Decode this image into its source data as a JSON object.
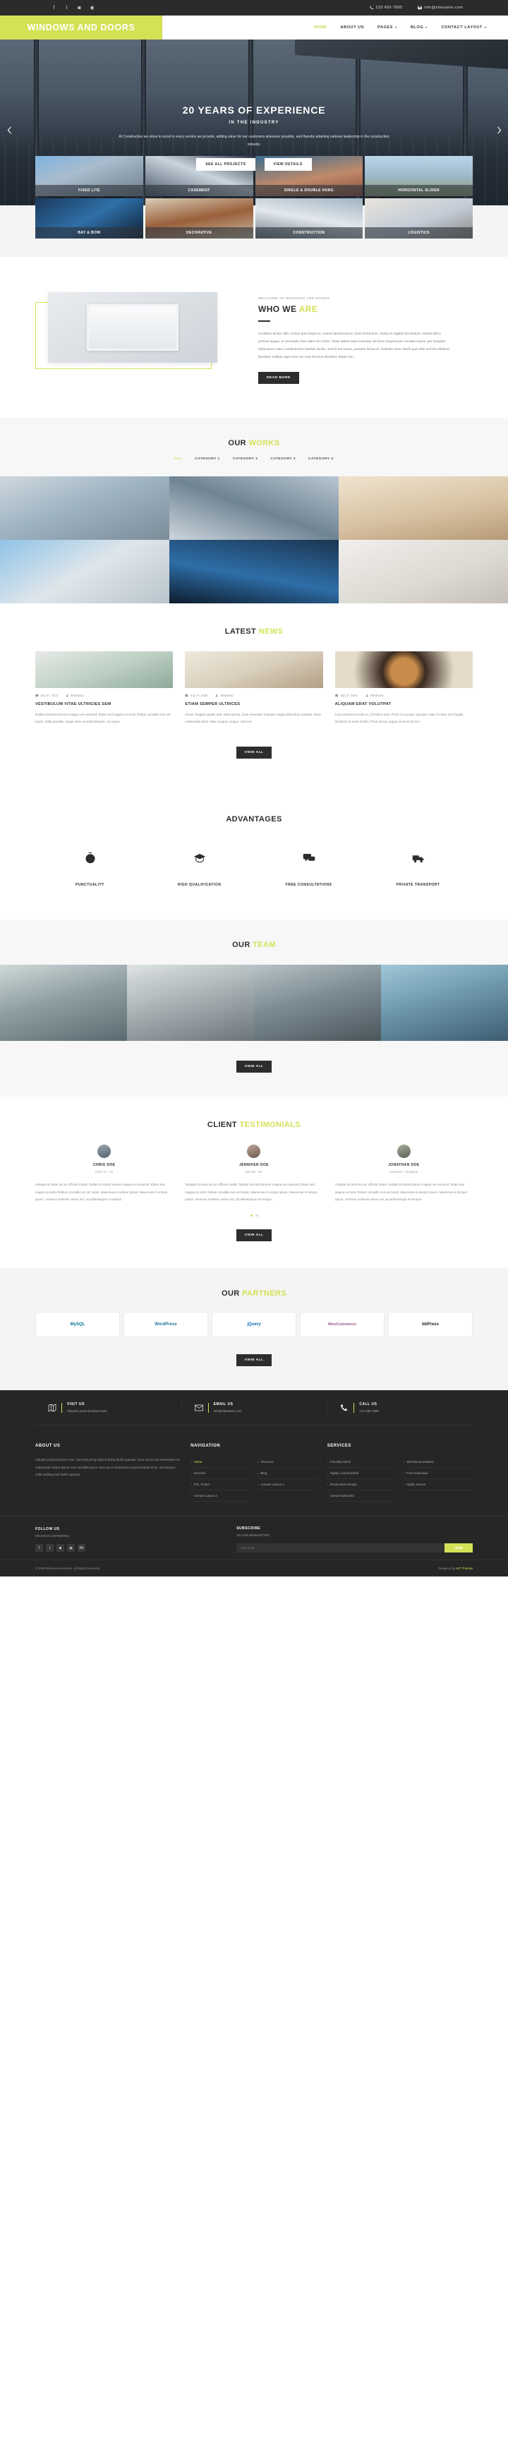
{
  "topbar": {
    "social": [
      "facebook-icon",
      "twitter-icon",
      "instagram-icon",
      "dribbble-icon"
    ],
    "phone": "233 456 7895",
    "email": "info@sitename.com"
  },
  "header": {
    "logo": "WINDOWS AND DOORS",
    "nav": [
      {
        "label": "HOME",
        "active": true,
        "caret": false
      },
      {
        "label": "ABOUT US",
        "active": false,
        "caret": false
      },
      {
        "label": "PAGES",
        "active": false,
        "caret": true
      },
      {
        "label": "BLOG",
        "active": false,
        "caret": true
      },
      {
        "label": "CONTACT LAYOUT",
        "active": false,
        "caret": true
      }
    ]
  },
  "hero": {
    "title": "20 YEARS OF EXPERIENCE",
    "subtitle": "IN THE INDUSTRY",
    "description": "At Construction we strive to excel in every service we provide, adding value for our customers wherever possible, and thereby attaining national leadership in the construction industry.",
    "primary_button": "SEE ALL PROJECTS",
    "secondary_button": "VIEW DETAILS"
  },
  "categories": [
    {
      "label": "FIXED LITE"
    },
    {
      "label": "CASEMENT"
    },
    {
      "label": "SINGLE & DOUBLE HUNG"
    },
    {
      "label": "HORIZONTAL SLIDER"
    },
    {
      "label": "BAY & BOW"
    },
    {
      "label": "DECORATIVE"
    },
    {
      "label": "CONSTRUCTION"
    },
    {
      "label": "LOGISTICS"
    }
  ],
  "who": {
    "eyebrow": "WELCOME TO WINDOWS AND DOORS",
    "title_main": "WHO WE ",
    "title_accent": "ARE",
    "body": "Curabitur lectus nibh, cursus quis turpis eu, viverra laoreet purus. Duis fermentum, metus et sagittis fermentum, massa libero pretium augue, in venenatis risus diam nec tortor. Class aptent taciti sociosqu ad litora torquent per conubia nostra, per inceptos himenaeos. Nam condimentum facilisis iaculis. Sed id est varius, posuere lectus id, molestie risus. Morbi quis nibh sed leo eleifend faucibus. Nullam eget urna non erat rhoncus tincidunt. Etiam non.",
    "button": "READ MORE"
  },
  "works": {
    "title_main": "OUR ",
    "title_accent": "WORKS",
    "filters": [
      {
        "label": "ALL",
        "active": true
      },
      {
        "label": "CATEGORY 1",
        "active": false
      },
      {
        "label": "CATEGORY 2",
        "active": false
      },
      {
        "label": "CATEGORY 3",
        "active": false
      },
      {
        "label": "CATEGORY 4",
        "active": false
      }
    ]
  },
  "news": {
    "title_main": "LATEST ",
    "title_accent": "NEWS",
    "button": "VIEW ALL",
    "posts": [
      {
        "date": "July 27, 2018",
        "author": "Windows1",
        "title": "VESTIBULUM VITAE ULTRICIES SEM",
        "excerpt": "Nullam tincidunt laoreet magna vel euismod. Etiam sed magna eu tortor finibus convallis non vel turpis. Nulla gravida, neque vitae suscipit aliquam, mi augue"
      },
      {
        "date": "July 27, 2018",
        "author": "Windows1",
        "title": "ETIAM SEMPER ULTRICES",
        "excerpt": "Donec feugiat sagittis ante vitae lacinia. Cras venenatis tristique magna bibendum sodales. Nunc malesuada diam vitae congue congue. Sed nec"
      },
      {
        "date": "July 27, 2018",
        "author": "Windows1",
        "title": "ALIQUAM ERAT VOLUTPAT",
        "excerpt": "Cras tincidunt iaculis ex, id finibus ante. Proin in mi justo. Quisque vitae mi vitae est fringilla tincidunt sit amet id felis. Proin luctus, augue sit amet dictum"
      }
    ]
  },
  "advantages": {
    "title": "ADVANTAGES",
    "items": [
      {
        "icon": "clock-icon",
        "label": "PUNCTUALITY"
      },
      {
        "icon": "graduation-cap-icon",
        "label": "HIGH QUALIFICATION"
      },
      {
        "icon": "chat-bubbles-icon",
        "label": "FREE CONSULTATIONS"
      },
      {
        "icon": "truck-icon",
        "label": "PRIVATE TRANSPORT"
      }
    ]
  },
  "team": {
    "title_main": "OUR ",
    "title_accent": "TEAM",
    "button": "VIEW ALL"
  },
  "testimonials": {
    "title_main": "CLIENT ",
    "title_accent": "TESTIMONIALS",
    "button": "VIEW ALL",
    "items": [
      {
        "name": "CHRIS DOE",
        "role": "Chief Art - UK",
        "text": "Volutpat sit amet leo at, efficitur mattis. Nullam tincidunt laoreet magna vel euismod. Etiam sed magna eu tortor finibus convallis non vel turpis. Maecenas in tempor ipsum. Maecenas in tempor ipsum. Vivamus molestie varius orci, at pellentesque mi tempor."
      },
      {
        "name": "JENNIFER DOE",
        "role": "Director - UK",
        "text": "Volutpat sit amet leo at, efficitur mattis. Nullam tincidunt laoreet magna vel euismod. Etiam sed magna eu tortor finibus convallis non vel turpis. Maecenas in tempor ipsum. Maecenas in tempor ipsum. Vivamus molestie varius orci, at pellentesque mi tempor."
      },
      {
        "name": "JONATHAN DOE",
        "role": "Executive - Shanghai",
        "text": "Volutpat sit amet leo at, efficitur mattis. Nullam tincidunt laoreet magna vel euismod. Etiam sed magna eu tortor finibus convallis non vel turpis. Maecenas in tempor ipsum. Maecenas in tempor ipsum. Vivamus molestie varius orci, at pellentesque mi tempor."
      }
    ]
  },
  "partners": {
    "title_main": "OUR ",
    "title_accent": "PARTNERS",
    "button": "VIEW ALL",
    "logos": [
      "MySQL",
      "WordPress",
      "jQuery",
      "WooCommerce",
      "bbPress"
    ]
  },
  "footer": {
    "contacts": [
      {
        "icon": "map-icon",
        "title": "VISIT US",
        "value": "Aliquam porta tincidunt enim."
      },
      {
        "icon": "envelope-icon",
        "title": "EMAIL US",
        "value": "info@sitename.com"
      },
      {
        "icon": "phone-icon",
        "title": "CALL US",
        "value": "123 456 7890"
      }
    ],
    "about": {
      "heading": "ABOUT US",
      "text": "Aliquam porta tincidunt enim. Sed temporing nulla sedding facilis egestas, lorem lacus and elementum mi, malesuada ornare ipsum erat convallis ipsum orem lacus elementum porta tincidunt enim. Sed tempor, nulla sedding into facilis egestas."
    },
    "navigation": {
      "heading": "NAVIGATION",
      "links": [
        {
          "label": "Home",
          "active": true
        },
        {
          "label": "About Us",
          "active": false
        },
        {
          "label": "Services",
          "active": false
        },
        {
          "label": "Blog",
          "active": false
        },
        {
          "label": "RTL Tested",
          "active": false
        },
        {
          "label": "Contact Layout 1",
          "active": false
        },
        {
          "label": "Contact Layout 2",
          "active": false
        }
      ]
    },
    "services": {
      "heading": "SERVICES",
      "links": [
        {
          "label": "Friendly Admin",
          "active": false
        },
        {
          "label": "Well Documentated",
          "active": false
        },
        {
          "label": "Highly Customizable",
          "active": false
        },
        {
          "label": "Free Download",
          "active": false
        },
        {
          "label": "Responsive Design",
          "active": false
        },
        {
          "label": "Highly Secure",
          "active": false
        },
        {
          "label": "Speed Optimized",
          "active": false
        }
      ]
    },
    "follow": {
      "title": "FOLLOW US",
      "subtitle": "ON SOCIAL NETWORKS",
      "social": [
        "facebook-icon",
        "twitter-icon",
        "instagram-icon",
        "dribbble-icon",
        "behance-icon"
      ]
    },
    "newsletter": {
      "title": "SUBSCRIBE",
      "subtitle": "ON OUR NEWSLETTER",
      "placeholder": "Your Email",
      "button": "SEND"
    },
    "copyright": "© 2018 Windows and Doors. All Rights Reserved.",
    "credit_prefix": "Designed by ",
    "credit_name": "AKT Themes"
  },
  "colors": {
    "accent": "#d4e157",
    "dark": "#2d2d2d",
    "footer_bg": "#262626"
  }
}
